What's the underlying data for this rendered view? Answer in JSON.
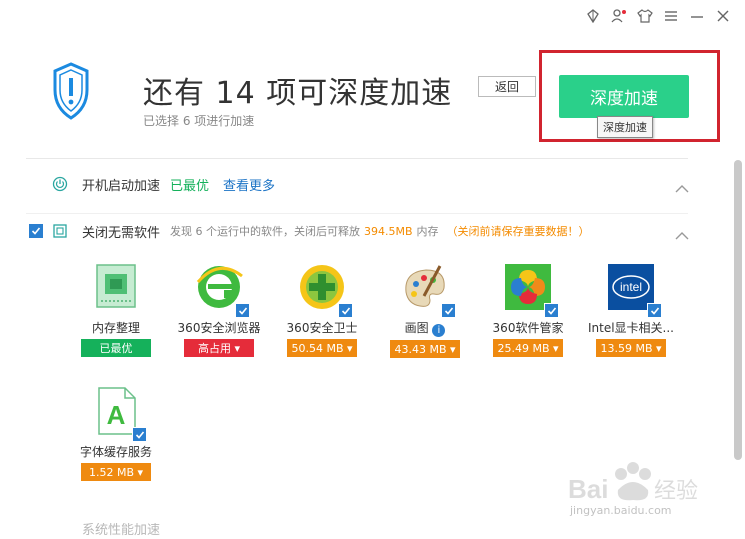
{
  "window_controls": [
    "skin-icon",
    "user-icon",
    "shirt-icon",
    "menu-icon",
    "minimize-icon",
    "close-icon"
  ],
  "header": {
    "title": "还有 14 项可深度加速",
    "subtitle": "已选择 6 项进行加速",
    "back_label": "返回",
    "accelerate_label": "深度加速",
    "tooltip": "深度加速"
  },
  "startup_section": {
    "title": "开机启动加速",
    "status": "已最优",
    "link": "查看更多"
  },
  "close_section": {
    "title": "关闭无需软件",
    "desc_prefix": "发现 6 个运行中的软件，关闭后可释放",
    "desc_amount": "394.5MB",
    "desc_suffix": "内存",
    "warning": "（关闭前请保存重要数据！）"
  },
  "apps": [
    {
      "name": "内存整理",
      "tag": "已最优",
      "tag_style": "green-b",
      "checked": false,
      "icon": "memory-chip-icon"
    },
    {
      "name": "360安全浏览器",
      "tag": "高占用 ▾",
      "tag_style": "red-b",
      "checked": true,
      "icon": "browser-e-icon"
    },
    {
      "name": "360安全卫士",
      "tag": "50.54 MB ▾",
      "tag_style": "orange-b",
      "checked": true,
      "icon": "guard-plus-icon"
    },
    {
      "name": "画图",
      "tag": "43.43 MB ▾",
      "tag_style": "orange-b",
      "checked": true,
      "icon": "paint-palette-icon"
    },
    {
      "name": "360软件管家",
      "tag": "25.49 MB ▾",
      "tag_style": "orange-b",
      "checked": true,
      "icon": "software-manager-icon"
    },
    {
      "name": "Intel显卡相关...",
      "tag": "13.59 MB ▾",
      "tag_style": "orange-b",
      "checked": true,
      "icon": "intel-icon"
    },
    {
      "name": "字体缓存服务",
      "tag": "1.52 MB ▾",
      "tag_style": "orange-b",
      "checked": true,
      "icon": "font-file-icon"
    }
  ],
  "next_section": {
    "title": "系统性能加速"
  },
  "watermark": {
    "logo": "Baidu经验",
    "url": "jingyan.baidu.com"
  }
}
